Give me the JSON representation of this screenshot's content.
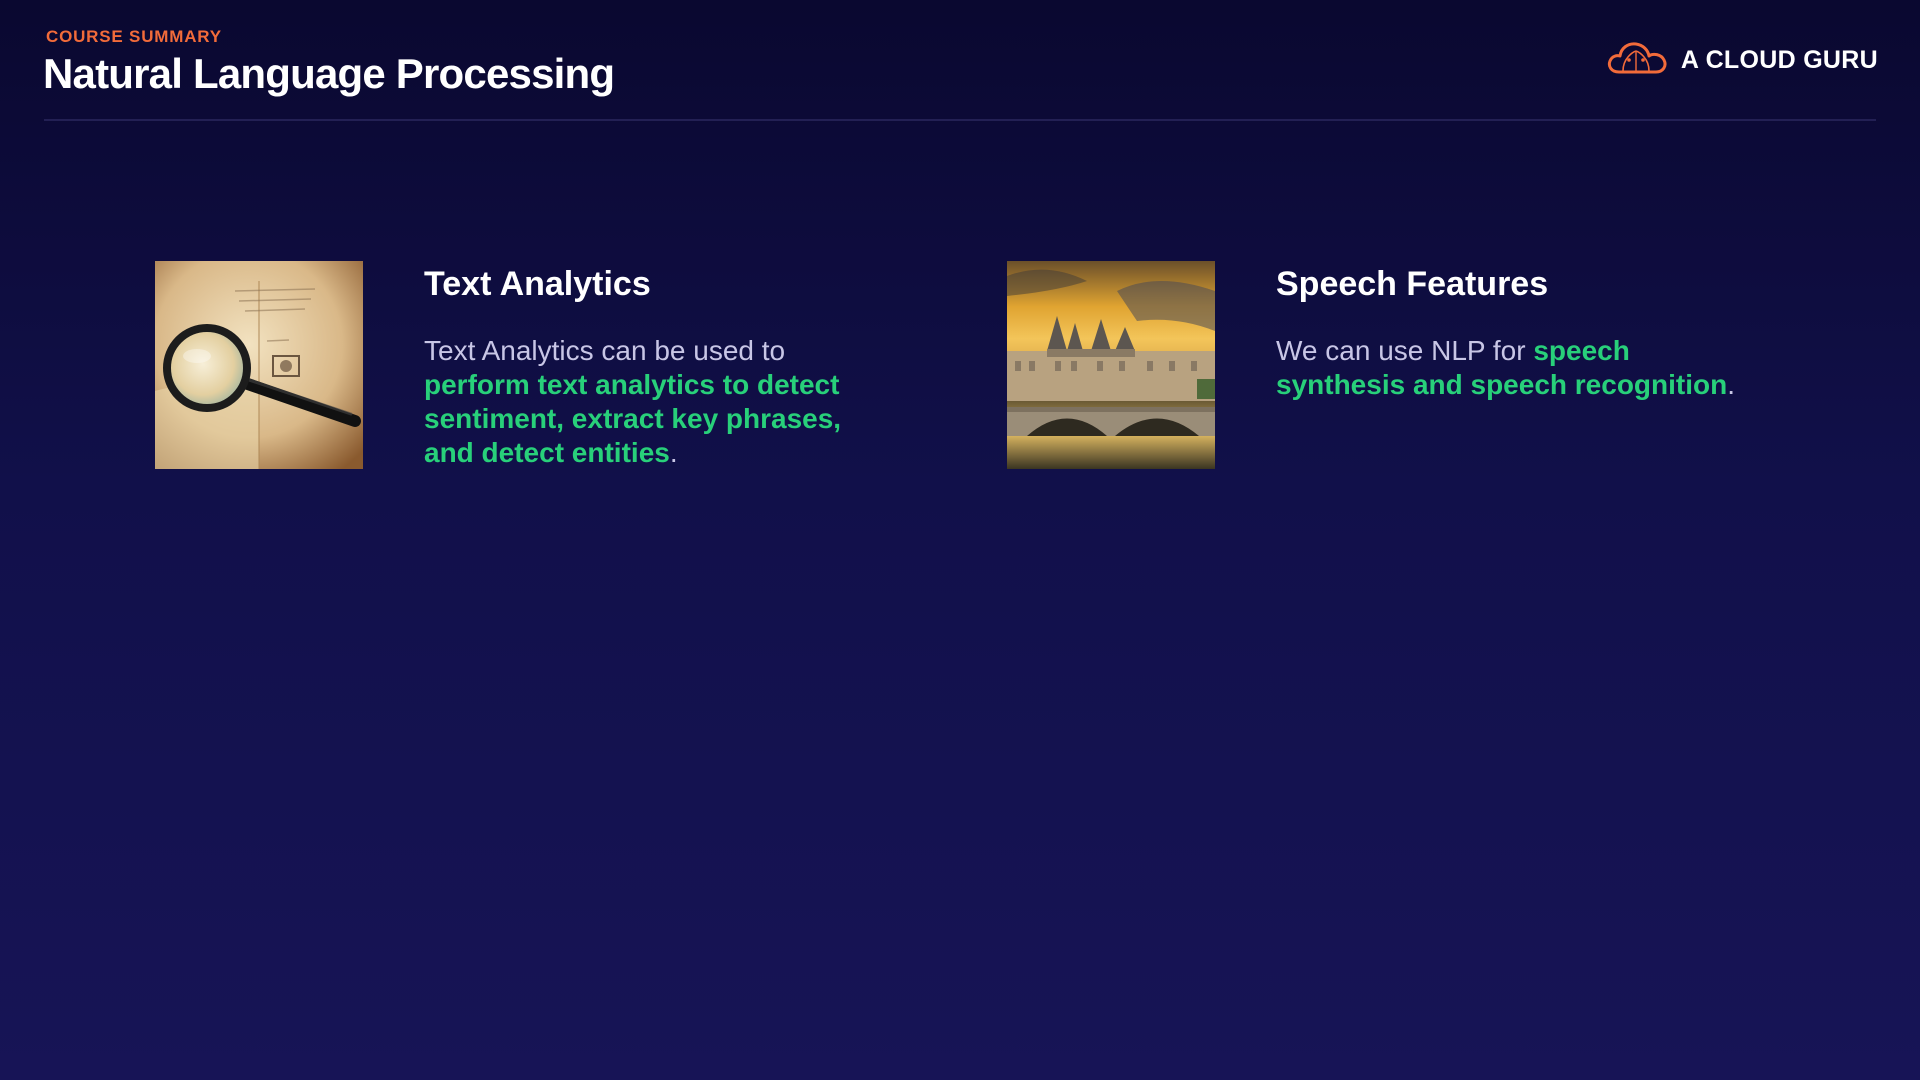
{
  "header": {
    "eyebrow": "COURSE SUMMARY",
    "title": "Natural Language Processing",
    "brand": "A CLOUD GURU"
  },
  "colors": {
    "accent_orange": "#f26b3a",
    "highlight_green": "#28d07a",
    "background": "#11104a"
  },
  "cards": [
    {
      "title": "Text Analytics",
      "image_icon": "magnifying-glass-on-book",
      "body_plain": "Text Analytics can be used to ",
      "body_highlight": "perform text analytics to detect sentiment, extract key phrases, and detect entities",
      "body_end": "."
    },
    {
      "title": "Speech Features",
      "image_icon": "castle-by-river-bridge",
      "body_plain": "We can use NLP for ",
      "body_highlight": "speech synthesis and speech recognition",
      "body_end": "."
    }
  ]
}
